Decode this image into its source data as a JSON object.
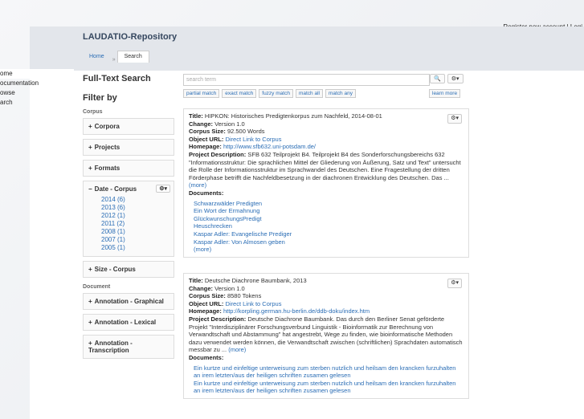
{
  "top_links": "Register new account | Logi",
  "app_title": "LAUDATIO-Repository",
  "tabs": [
    "Home",
    "»",
    "Search"
  ],
  "side_nav": [
    "ome",
    "ocumentation",
    "owse",
    "arch"
  ],
  "left": {
    "heading": "Full-Text Search",
    "filter_by": "Filter by",
    "section_corpus": "Corpus",
    "corpora": "Corpora",
    "projects": "Projects",
    "formats": "Formats",
    "date_corpus": "Date - Corpus",
    "date_values": [
      "2014 (6)",
      "2013 (6)",
      "2012 (1)",
      "2011 (2)",
      "2008 (1)",
      "2007 (1)",
      "2005 (1)"
    ],
    "size_corpus": "Size - Corpus",
    "section_document": "Document",
    "annotation_graphical": "Annotation - Graphical",
    "annotation_lexical": "Annotation - Lexical",
    "annotation_transcription": "Annotation - Transcription"
  },
  "search": {
    "placeholder": "search term",
    "search_icon": "search-icon",
    "gear_icon": "gear-icon",
    "modes": [
      "partial match",
      "exact match",
      "fuzzy match",
      "match all",
      "match any"
    ],
    "learn_more": "learn more"
  },
  "results": [
    {
      "title_label": "Title:",
      "title": "HIPKON: Historisches Predigtenkorpus zum Nachfeld, 2014-08-01",
      "change_label": "Change:",
      "change": "Version 1.0",
      "size_label": "Corpus Size:",
      "size": "92.500 Words",
      "url_label": "Object URL:",
      "url": "Direct Link to Corpus",
      "homepage_label": "Homepage:",
      "homepage": "http://www.sfb632.uni-potsdam.de/",
      "desc_label": "Project Description:",
      "desc": "SFB 632 Teilprojekt B4. Teilprojekt B4 des Sonderforschungsbereichs 632 \"Informationsstruktur: Die sprachlichen Mittel der Gliederung von Äußerung, Satz und Text\" untersucht die Rolle der Informationsstruktur im Sprachwandel des Deutschen. Eine Fragestellung der dritten Förderphase betrifft die Nachfeldbesetzung in der diachronen Entwicklung des Deutschen. Das ...",
      "more": "(more)",
      "docs_label": "Documents:",
      "docs": [
        "Schwarzwälder Predigten",
        "Ein Wort der Ermahnung",
        "GlückwunschungsPredigt",
        "Heuschrecken",
        "Kaspar Adler: Evangelische Prediger",
        "Kaspar Adler: Von Almosen geben"
      ],
      "docs_more": "(more)"
    },
    {
      "title_label": "Title:",
      "title": "Deutsche Diachrone Baumbank, 2013",
      "change_label": "Change:",
      "change": "Version 1.0",
      "size_label": "Corpus Size:",
      "size": "8580 Tokens",
      "url_label": "Object URL:",
      "url": "Direct Link to Corpus",
      "homepage_label": "Homepage:",
      "homepage": "http://korpling.german.hu-berlin.de/ddb-doku/index.htm",
      "desc_label": "Project Description:",
      "desc": "Deutsche Diachrone Baumbank. Das durch den Berliner Senat geförderte Projekt \"Interdisziplinärer Forschungsverbund Linguistik - Bioinformatik zur Berechnung von Verwandtschaft und Abstammung\" hat angestrebt, Wege zu finden, wie bioinformatische Methoden dazu verwendet werden können, die Verwandtschaft zwischen (schriftlichen) Sprachdaten automatisch messbar zu ...",
      "more": "(more)",
      "docs_label": "Documents:",
      "docs": [
        "Ein kurtze und einfeltige unterweisung zum sterben nutzlich und heilsam den krancken furzuhalten an irem letzten/aus der heiligen schriften zusamen gelesen",
        "Ein kurtze und einfeltige unterweisung zum sterben nutzlich und heilsam den krancken furzuhalten an irem letzten/aus der heiligen schriften zusamen gelesen"
      ],
      "docs_more": ""
    }
  ]
}
